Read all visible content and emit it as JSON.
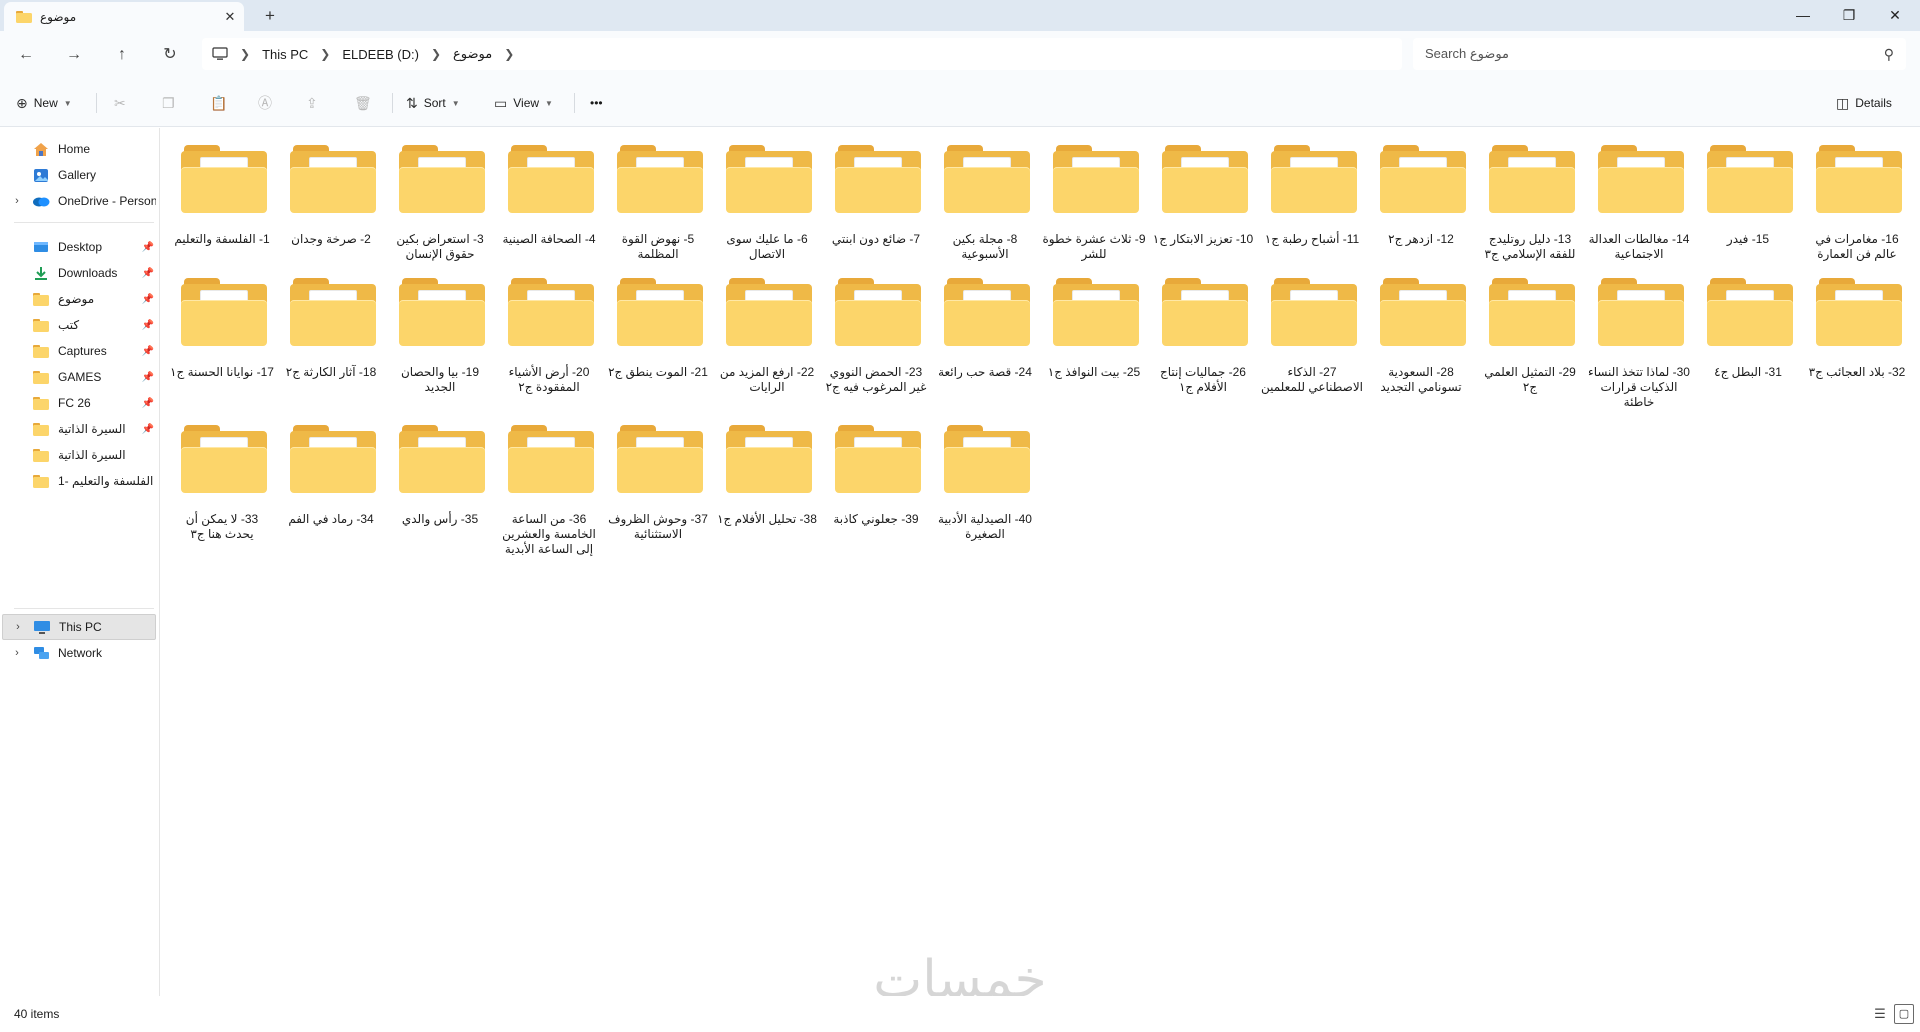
{
  "tab": {
    "title": "موضوع",
    "close": "✕",
    "new": "+"
  },
  "window": {
    "minimize": "—",
    "maximize": "❐",
    "close": "✕"
  },
  "nav": {
    "back": "←",
    "forward": "→",
    "up": "↑",
    "refresh": "↻"
  },
  "breadcrumb": {
    "items": [
      "This PC",
      "ELDEEB (D:)",
      "موضوع"
    ]
  },
  "search": {
    "placeholder": "Search موضوع"
  },
  "commands": {
    "new": "New",
    "sort": "Sort",
    "view": "View",
    "more": "•••",
    "details": "Details"
  },
  "sidebar": {
    "items": [
      {
        "label": "Home",
        "icon": "home-icon"
      },
      {
        "label": "Gallery",
        "icon": "gallery-icon"
      },
      {
        "label": "OneDrive - Persona",
        "icon": "onedrive-icon"
      },
      {
        "label": "Desktop",
        "icon": "desktop-icon"
      },
      {
        "label": "Downloads",
        "icon": "downloads-icon"
      },
      {
        "label": "موضوع",
        "icon": "folder-icon"
      },
      {
        "label": "كتب",
        "icon": "folder-icon"
      },
      {
        "label": "Captures",
        "icon": "folder-icon"
      },
      {
        "label": "GAMES",
        "icon": "folder-icon"
      },
      {
        "label": "FC 26",
        "icon": "folder-icon"
      },
      {
        "label": "السيرة الذاتية",
        "icon": "folder-icon"
      },
      {
        "label": "السيرة الذاتية",
        "icon": "folder-icon"
      },
      {
        "label": "1- الفلسفة والتعليم",
        "icon": "folder-icon"
      },
      {
        "label": "This PC",
        "icon": "this-pc-icon"
      },
      {
        "label": "Network",
        "icon": "network-icon"
      }
    ]
  },
  "folders": [
    "1- الفلسفة والتعليم",
    "2- صرخة وجدان",
    "3- استعراض بكين حقوق الإنسان",
    "4- الصحافة الصينية",
    "5- نهوض القوة المظلمة",
    "6- ما عليك سوى الاتصال",
    "7- ضائع دون ابنتي",
    "8- مجلة بكين الأسبوعية",
    "9- ثلاث عشرة خطوة للشر",
    "10- تعزيز الابتكار ج١",
    "11- أشباح رطبة ج١",
    "12- ازدهر ج٢",
    "13- دليل روتليدج للفقه الإسلامي ج٣",
    "14- مغالطات العدالة الاجتماعية",
    "15- فيدر",
    "16- مغامرات في عالم فن العمارة",
    "17- نوايانا الحسنة ج١",
    "18- آثار الكارثة ج٢",
    "19- بيا والحصان الجديد",
    "20- أرض الأشياء المفقودة ج٢",
    "21- الموت ينطق ج٢",
    "22- ارفع المزيد من الرايات",
    "23- الحمض النووي غير المرغوب فيه ج٢",
    "24- قصة حب رائعة",
    "25- بيت النوافذ ج١",
    "26- جماليات إنتاج الأفلام ج١",
    "27- الذكاء الاصطناعي للمعلمين",
    "28- السعودية تسونامي التجديد",
    "29- التمثيل العلمي ج٢",
    "30- لماذا تتخذ النساء الذكيات قرارات خاطئة",
    "31- البطل ج٤",
    "32- بلاد العجائب ج٣",
    "33- لا يمكن أن يحدث هنا ج٣",
    "34- رماد في الفم",
    "35- رأس والدي",
    "36- من الساعة الخامسة والعشرين إلى الساعة الأبدية",
    "37- وحوش الظروف الاستثنائية",
    "38- تحليل الأفلام ج١",
    "39- جعلوني كاذبة",
    "40- الصيدلية الأدبية الصغيرة"
  ],
  "status": {
    "count": "40 items"
  },
  "watermark": "خمسات"
}
